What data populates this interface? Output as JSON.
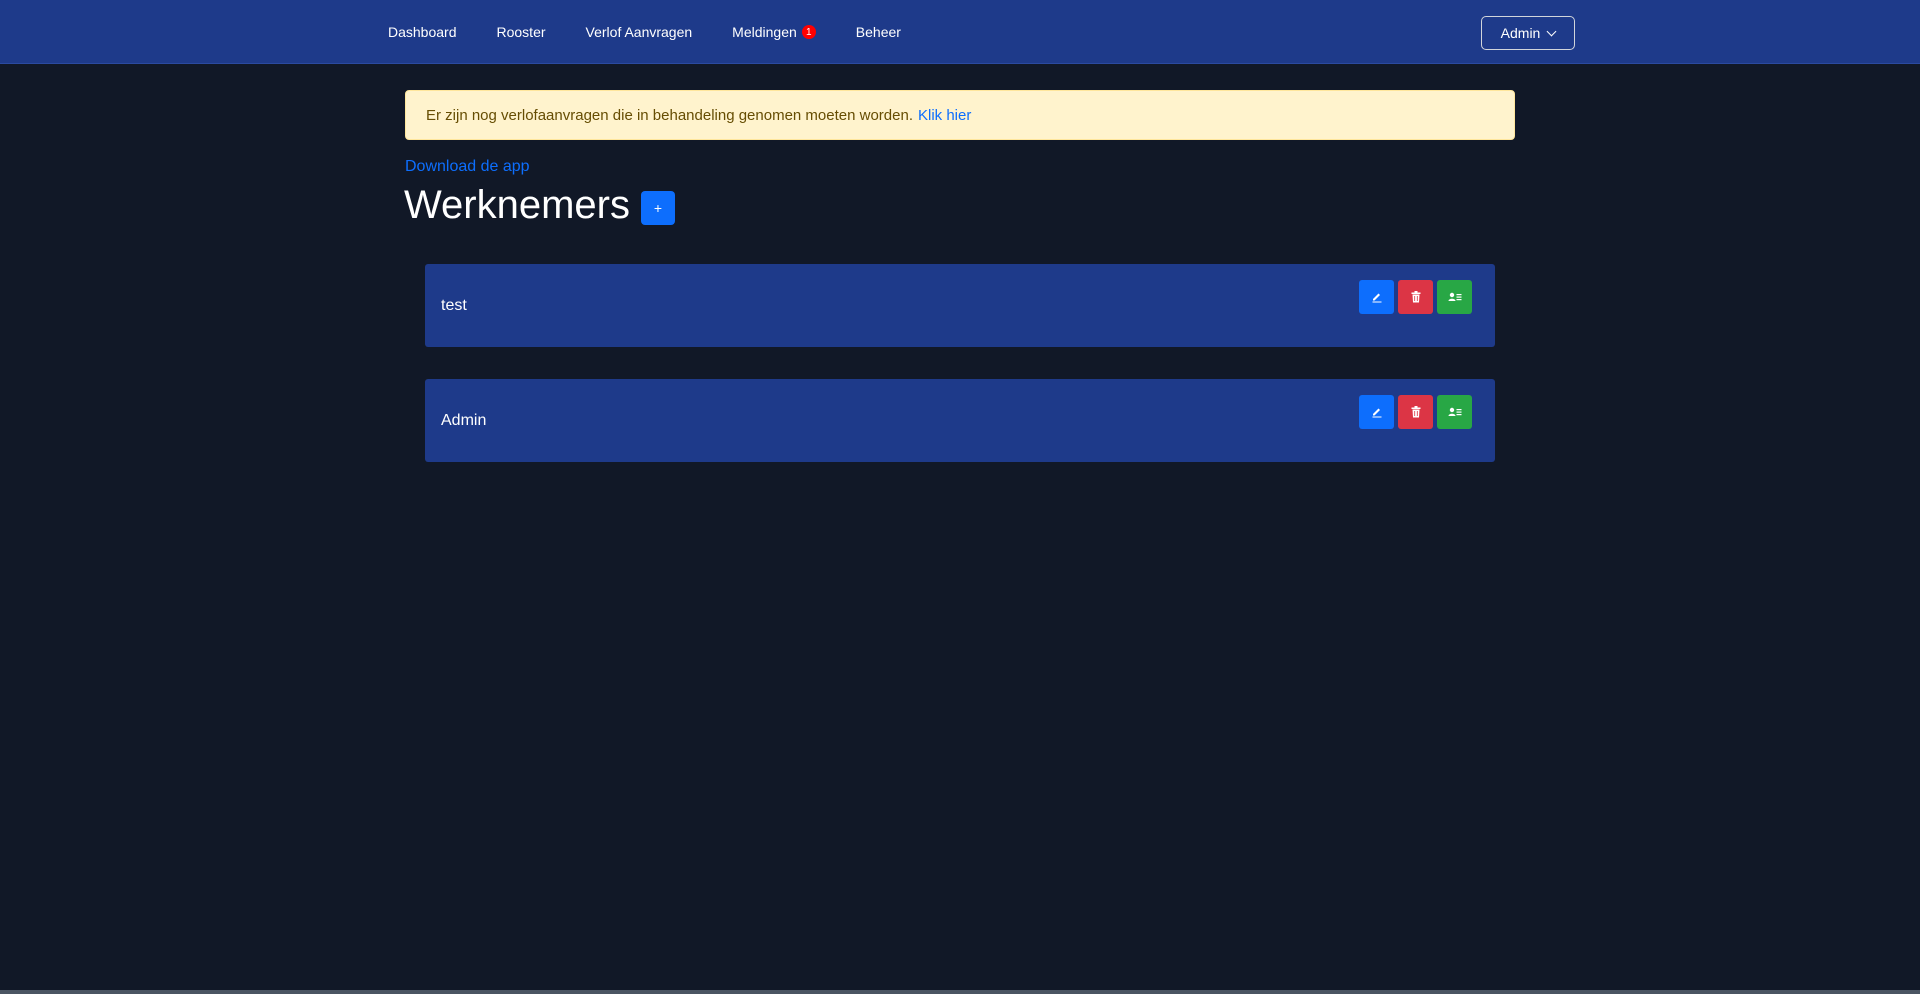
{
  "nav": {
    "items": [
      {
        "label": "Dashboard"
      },
      {
        "label": "Rooster"
      },
      {
        "label": "Verlof Aanvragen"
      },
      {
        "label": "Meldingen",
        "badge": "1"
      },
      {
        "label": "Beheer"
      }
    ],
    "user_menu_label": "Admin"
  },
  "alert": {
    "text": "Er zijn nog verlofaanvragen die in behandeling genomen moeten worden.",
    "link_text": "Klik hier"
  },
  "download_link": "Download de app",
  "page_title": "Werknemers",
  "add_button_label": "+",
  "employees": [
    {
      "name": "test"
    },
    {
      "name": "Admin"
    }
  ],
  "colors": {
    "navbar": "#1e3a8a",
    "background": "#111827",
    "primary": "#0d6efd",
    "danger": "#dc3545",
    "success": "#28a745",
    "alert_bg": "#fff3cd"
  },
  "icons": {
    "edit": "pencil-icon",
    "delete": "trash-icon",
    "user": "user-card-icon",
    "dropdown": "chevron-down-icon"
  }
}
